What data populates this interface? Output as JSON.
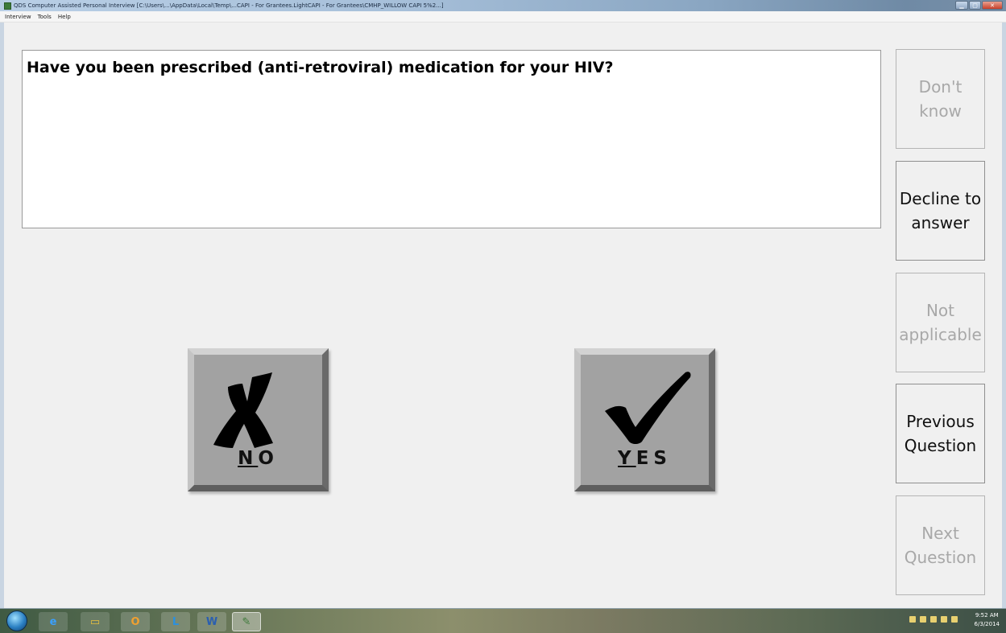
{
  "window": {
    "title": "QDS Computer Assisted Personal Interview [C:\\Users\\...\\AppData\\Local\\Temp\\...CAPI - For Grantees.LightCAPI - For Grantees\\CMHP_WILLOW CAPI 5%2...]"
  },
  "menu": {
    "items": [
      "Interview",
      "Tools",
      "Help"
    ]
  },
  "question": {
    "text": "Have you been prescribed (anti-retroviral) medication for your HIV?"
  },
  "side_buttons": [
    {
      "label": "Don't\nknow",
      "enabled": false
    },
    {
      "label": "Decline to\nanswer",
      "enabled": true
    },
    {
      "label": "Not\napplicable",
      "enabled": false
    },
    {
      "label": "Previous\nQuestion",
      "enabled": true
    },
    {
      "label": "Next\nQuestion",
      "enabled": false
    }
  ],
  "answers": {
    "no": {
      "hotkey": "N",
      "rest": "O",
      "icon": "x-mark-icon"
    },
    "yes": {
      "hotkey": "Y",
      "rest": "ES",
      "icon": "check-mark-icon"
    }
  },
  "taskbar": {
    "clock_time": "9:52 AM",
    "clock_date": "6/3/2014",
    "icons": [
      "start-orb",
      "internet-explorer-icon",
      "file-explorer-icon",
      "outlook-icon",
      "lync-icon",
      "word-icon",
      "qds-app-icon"
    ]
  },
  "colors": {
    "background": "#f0f0f0",
    "answer_button": "#a2a2a2",
    "disabled_text": "#a8a8a8"
  }
}
